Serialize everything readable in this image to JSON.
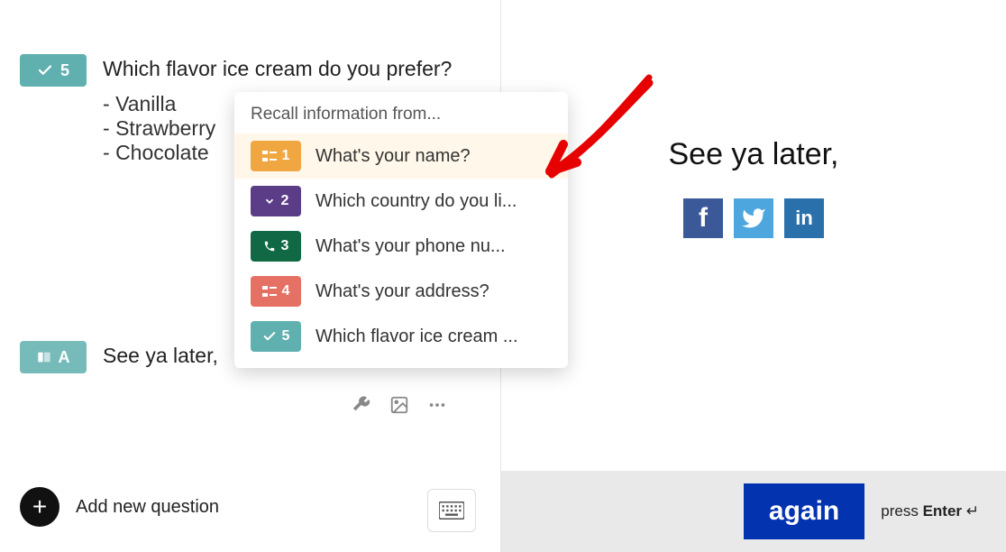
{
  "left": {
    "q5": {
      "badge_num": "5",
      "text": "Which flavor ice cream do you prefer?",
      "options": [
        "Vanilla",
        "Strawberry",
        "Chocolate"
      ]
    },
    "qa": {
      "badge_letter": "A",
      "text": "See ya later,"
    },
    "add_label": "Add new question"
  },
  "recall": {
    "title": "Recall information from...",
    "items": [
      {
        "num": "1",
        "label": "What's your name?",
        "color": "rb-orange",
        "icon": "form-icon",
        "selected": true
      },
      {
        "num": "2",
        "label": "Which country do you li...",
        "color": "rb-purple",
        "icon": "chevron-down-icon",
        "selected": false
      },
      {
        "num": "3",
        "label": "What's your phone nu...",
        "color": "rb-green",
        "icon": "phone-icon",
        "selected": false
      },
      {
        "num": "4",
        "label": "What's your address?",
        "color": "rb-coral",
        "icon": "form-icon",
        "selected": false
      },
      {
        "num": "5",
        "label": "Which flavor ice cream ...",
        "color": "rb-teal",
        "icon": "check-icon",
        "selected": false
      }
    ]
  },
  "preview": {
    "headline": "See ya later,",
    "again_label": "again",
    "press_prefix": "press ",
    "press_key": "Enter"
  }
}
